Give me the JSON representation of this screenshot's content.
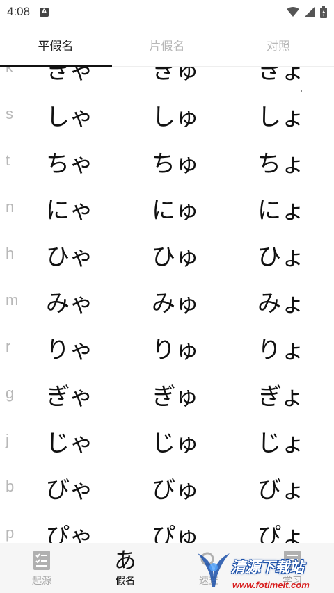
{
  "status_bar": {
    "time": "4:08",
    "notification_glyph": "A",
    "icons": [
      "wifi-icon",
      "signal-icon",
      "battery-icon"
    ]
  },
  "tabs": [
    {
      "label": "平假名",
      "active": true
    },
    {
      "label": "片假名",
      "active": false
    },
    {
      "label": "对照",
      "active": false
    }
  ],
  "rows": [
    {
      "label": "k",
      "cells": [
        "きゃ",
        "きゅ",
        "きょ"
      ]
    },
    {
      "label": "s",
      "cells": [
        "しゃ",
        "しゅ",
        "しょ"
      ]
    },
    {
      "label": "t",
      "cells": [
        "ちゃ",
        "ちゅ",
        "ちょ"
      ]
    },
    {
      "label": "n",
      "cells": [
        "にゃ",
        "にゅ",
        "にょ"
      ]
    },
    {
      "label": "h",
      "cells": [
        "ひゃ",
        "ひゅ",
        "ひょ"
      ]
    },
    {
      "label": "m",
      "cells": [
        "みゃ",
        "みゅ",
        "みょ"
      ]
    },
    {
      "label": "r",
      "cells": [
        "りゃ",
        "りゅ",
        "りょ"
      ]
    },
    {
      "label": "g",
      "cells": [
        "ぎゃ",
        "ぎゅ",
        "ぎょ"
      ]
    },
    {
      "label": "j",
      "cells": [
        "じゃ",
        "じゅ",
        "じょ"
      ]
    },
    {
      "label": "b",
      "cells": [
        "びゃ",
        "びゅ",
        "びょ"
      ]
    },
    {
      "label": "p",
      "cells": [
        "ぴゃ",
        "ぴゅ",
        "ぴょ"
      ]
    }
  ],
  "bottom_nav": [
    {
      "label": "起源",
      "icon": "checklist-icon",
      "active": false
    },
    {
      "label": "假名",
      "icon": "hiragana-a-icon",
      "glyph": "あ",
      "active": true
    },
    {
      "label": "速查",
      "icon": "search-icon",
      "active": false
    },
    {
      "label": "学习",
      "icon": "study-icon",
      "active": false
    }
  ],
  "watermark": {
    "title": "清源下载站",
    "url": "www.fotimeit.com"
  },
  "colors": {
    "active_text": "#111111",
    "inactive_text": "#b8b8b8",
    "nav_background": "#f6f6f6",
    "watermark_red": "#d81e1e",
    "watermark_blue": "#1a4fa8"
  }
}
